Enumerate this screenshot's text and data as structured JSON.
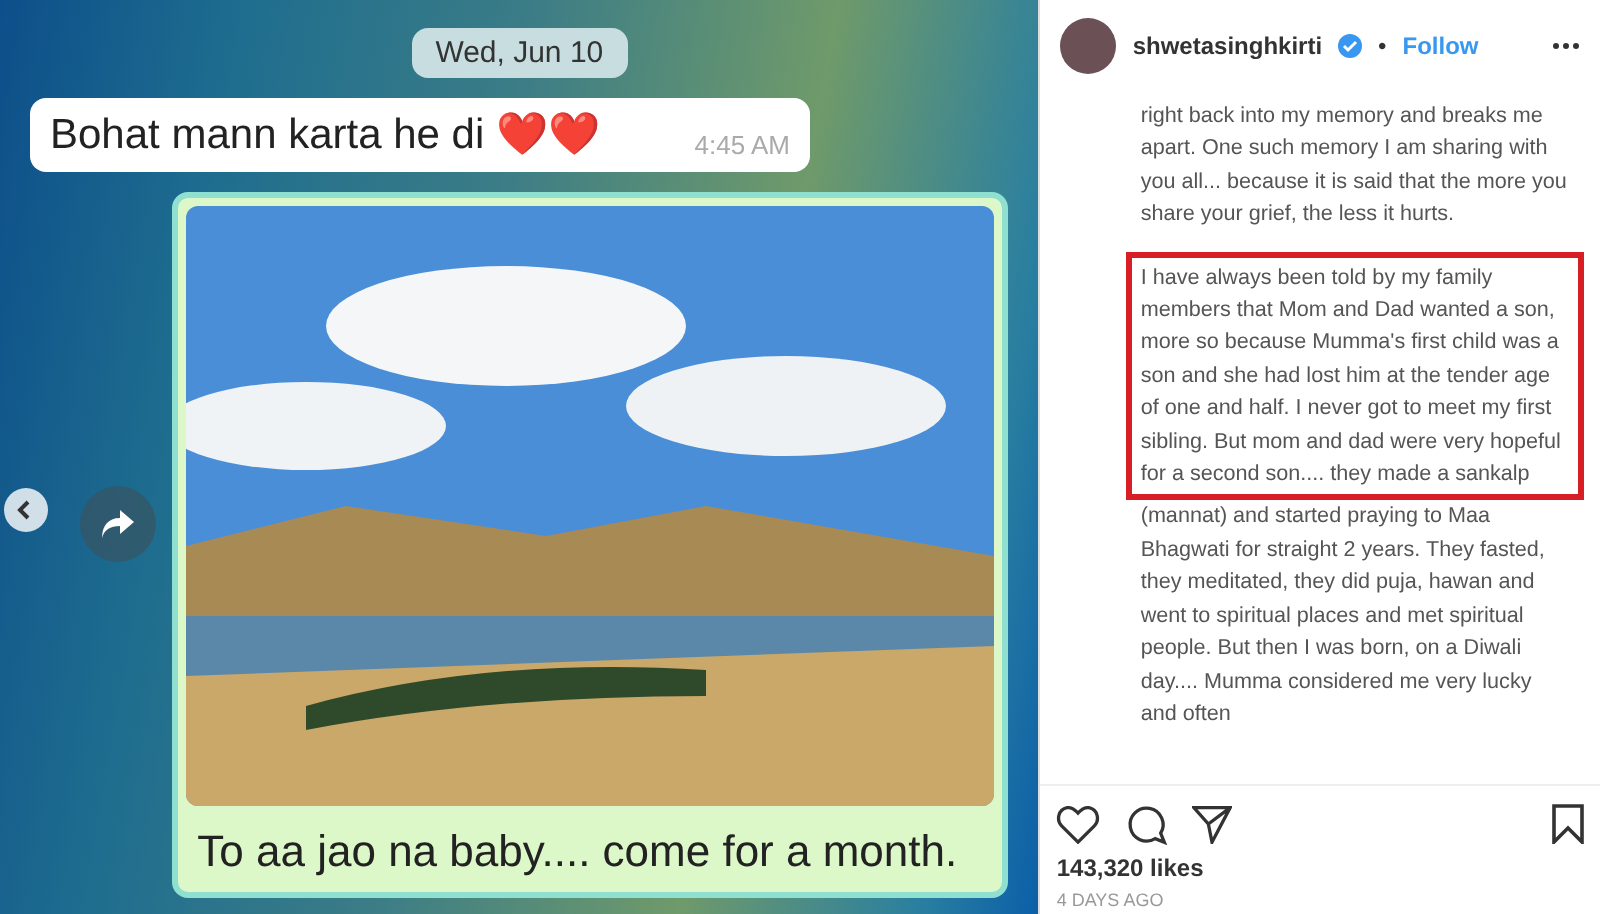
{
  "post_image": {
    "date_chip": "Wed, Jun 10",
    "messages": [
      {
        "kind": "text",
        "text": "Bohat mann karta he di ❤️❤️",
        "time": "4:45 AM"
      },
      {
        "kind": "photo",
        "caption": "To aa jao na baby.... come for a month."
      }
    ]
  },
  "header": {
    "username": "shwetasinghkirti",
    "verified": true,
    "separator": "•",
    "follow": "Follow"
  },
  "caption": [
    {
      "text": "right back into my memory and breaks me apart. One such memory I am sharing with you all... because it is said that the more you share your grief, the less it hurts.",
      "highlighted": false
    },
    {
      "text": "I have always been told by my family members that Mom and Dad wanted a son, more so because Mumma's first child was a son and she had lost him at the tender age of one and half. I never got to meet my first sibling. But mom and dad were very hopeful for a second son.... they made a sankalp",
      "highlighted": true
    },
    {
      "text": "(mannat) and started praying to Maa Bhagwati for straight 2 years. They fasted, they meditated, they did puja, hawan and went to spiritual places and met spiritual people. But then I was born, on a Diwali day.... Mumma considered me very lucky and often",
      "highlighted": false
    }
  ],
  "likes": "143,320 likes",
  "posted": "4 DAYS AGO"
}
